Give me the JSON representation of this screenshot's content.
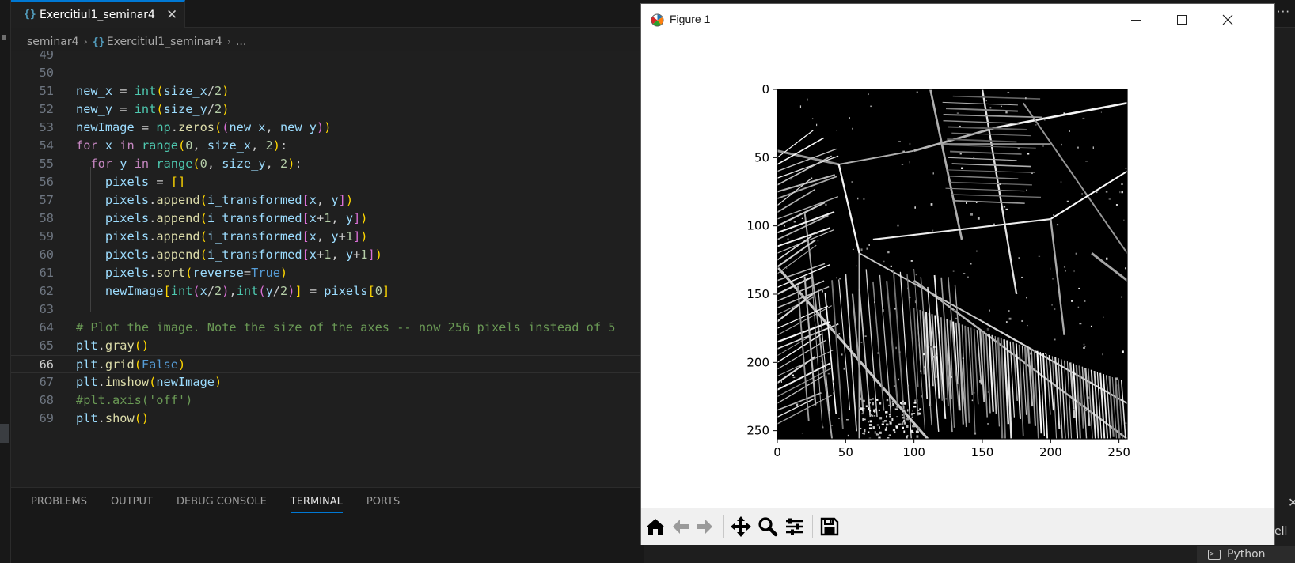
{
  "editor_tab": {
    "label": "Exercitiul1_seminar4",
    "close_glyph": "✕",
    "icon": "python-file-icon"
  },
  "more_actions_glyph": "···",
  "breadcrumb": {
    "folder": "seminar4",
    "file": "Exercitiul1_seminar4",
    "symbol": "..."
  },
  "editor": {
    "current_line": 66,
    "lines": [
      {
        "n": "49",
        "tokens": []
      },
      {
        "n": "50",
        "tokens": []
      },
      {
        "n": "51",
        "tokens": [
          [
            "new_x",
            "t-var"
          ],
          [
            " = ",
            "t-plain"
          ],
          [
            "int",
            "t-type"
          ],
          [
            "(",
            "t-paren1"
          ],
          [
            "size_x",
            "t-var"
          ],
          [
            "/",
            "t-plain"
          ],
          [
            "2",
            "t-num"
          ],
          [
            ")",
            "t-paren1"
          ]
        ]
      },
      {
        "n": "52",
        "tokens": [
          [
            "new_y",
            "t-var"
          ],
          [
            " = ",
            "t-plain"
          ],
          [
            "int",
            "t-type"
          ],
          [
            "(",
            "t-paren1"
          ],
          [
            "size_y",
            "t-var"
          ],
          [
            "/",
            "t-plain"
          ],
          [
            "2",
            "t-num"
          ],
          [
            ")",
            "t-paren1"
          ]
        ]
      },
      {
        "n": "53",
        "tokens": [
          [
            "newImage",
            "t-var"
          ],
          [
            " = ",
            "t-plain"
          ],
          [
            "np",
            "t-type"
          ],
          [
            ".",
            "t-plain"
          ],
          [
            "zeros",
            "t-func"
          ],
          [
            "(",
            "t-paren1"
          ],
          [
            "(",
            "t-paren2"
          ],
          [
            "new_x",
            "t-var"
          ],
          [
            ", ",
            "t-plain"
          ],
          [
            "new_y",
            "t-var"
          ],
          [
            ")",
            "t-paren2"
          ],
          [
            ")",
            "t-paren1"
          ]
        ]
      },
      {
        "n": "54",
        "tokens": [
          [
            "for",
            "t-kw"
          ],
          [
            " ",
            "t-plain"
          ],
          [
            "x",
            "t-var"
          ],
          [
            " ",
            "t-plain"
          ],
          [
            "in",
            "t-kw"
          ],
          [
            " ",
            "t-plain"
          ],
          [
            "range",
            "t-type"
          ],
          [
            "(",
            "t-paren1"
          ],
          [
            "0",
            "t-num"
          ],
          [
            ", ",
            "t-plain"
          ],
          [
            "size_x",
            "t-var"
          ],
          [
            ", ",
            "t-plain"
          ],
          [
            "2",
            "t-num"
          ],
          [
            ")",
            "t-paren1"
          ],
          [
            ":",
            "t-plain"
          ]
        ]
      },
      {
        "n": "55",
        "tokens": [
          [
            "  ",
            "t-plain"
          ],
          [
            "for",
            "t-kw"
          ],
          [
            " ",
            "t-plain"
          ],
          [
            "y",
            "t-var"
          ],
          [
            " ",
            "t-plain"
          ],
          [
            "in",
            "t-kw"
          ],
          [
            " ",
            "t-plain"
          ],
          [
            "range",
            "t-type"
          ],
          [
            "(",
            "t-paren1"
          ],
          [
            "0",
            "t-num"
          ],
          [
            ", ",
            "t-plain"
          ],
          [
            "size_y",
            "t-var"
          ],
          [
            ", ",
            "t-plain"
          ],
          [
            "2",
            "t-num"
          ],
          [
            ")",
            "t-paren1"
          ],
          [
            ":",
            "t-plain"
          ]
        ]
      },
      {
        "n": "56",
        "tokens": [
          [
            "    ",
            "t-plain"
          ],
          [
            "pixels",
            "t-var"
          ],
          [
            " = ",
            "t-plain"
          ],
          [
            "[]",
            "t-paren1"
          ]
        ]
      },
      {
        "n": "57",
        "tokens": [
          [
            "    ",
            "t-plain"
          ],
          [
            "pixels",
            "t-var"
          ],
          [
            ".",
            "t-plain"
          ],
          [
            "append",
            "t-func"
          ],
          [
            "(",
            "t-paren1"
          ],
          [
            "i_transformed",
            "t-var"
          ],
          [
            "[",
            "t-paren2"
          ],
          [
            "x",
            "t-var"
          ],
          [
            ", ",
            "t-plain"
          ],
          [
            "y",
            "t-var"
          ],
          [
            "]",
            "t-paren2"
          ],
          [
            ")",
            "t-paren1"
          ]
        ]
      },
      {
        "n": "58",
        "tokens": [
          [
            "    ",
            "t-plain"
          ],
          [
            "pixels",
            "t-var"
          ],
          [
            ".",
            "t-plain"
          ],
          [
            "append",
            "t-func"
          ],
          [
            "(",
            "t-paren1"
          ],
          [
            "i_transformed",
            "t-var"
          ],
          [
            "[",
            "t-paren2"
          ],
          [
            "x",
            "t-var"
          ],
          [
            "+",
            "t-plain"
          ],
          [
            "1",
            "t-num"
          ],
          [
            ", ",
            "t-plain"
          ],
          [
            "y",
            "t-var"
          ],
          [
            "]",
            "t-paren2"
          ],
          [
            ")",
            "t-paren1"
          ]
        ]
      },
      {
        "n": "59",
        "tokens": [
          [
            "    ",
            "t-plain"
          ],
          [
            "pixels",
            "t-var"
          ],
          [
            ".",
            "t-plain"
          ],
          [
            "append",
            "t-func"
          ],
          [
            "(",
            "t-paren1"
          ],
          [
            "i_transformed",
            "t-var"
          ],
          [
            "[",
            "t-paren2"
          ],
          [
            "x",
            "t-var"
          ],
          [
            ", ",
            "t-plain"
          ],
          [
            "y",
            "t-var"
          ],
          [
            "+",
            "t-plain"
          ],
          [
            "1",
            "t-num"
          ],
          [
            "]",
            "t-paren2"
          ],
          [
            ")",
            "t-paren1"
          ]
        ]
      },
      {
        "n": "60",
        "tokens": [
          [
            "    ",
            "t-plain"
          ],
          [
            "pixels",
            "t-var"
          ],
          [
            ".",
            "t-plain"
          ],
          [
            "append",
            "t-func"
          ],
          [
            "(",
            "t-paren1"
          ],
          [
            "i_transformed",
            "t-var"
          ],
          [
            "[",
            "t-paren2"
          ],
          [
            "x",
            "t-var"
          ],
          [
            "+",
            "t-plain"
          ],
          [
            "1",
            "t-num"
          ],
          [
            ", ",
            "t-plain"
          ],
          [
            "y",
            "t-var"
          ],
          [
            "+",
            "t-plain"
          ],
          [
            "1",
            "t-num"
          ],
          [
            "]",
            "t-paren2"
          ],
          [
            ")",
            "t-paren1"
          ]
        ]
      },
      {
        "n": "61",
        "tokens": [
          [
            "    ",
            "t-plain"
          ],
          [
            "pixels",
            "t-var"
          ],
          [
            ".",
            "t-plain"
          ],
          [
            "sort",
            "t-func"
          ],
          [
            "(",
            "t-paren1"
          ],
          [
            "reverse",
            "t-var"
          ],
          [
            "=",
            "t-plain"
          ],
          [
            "True",
            "t-const"
          ],
          [
            ")",
            "t-paren1"
          ]
        ]
      },
      {
        "n": "62",
        "tokens": [
          [
            "    ",
            "t-plain"
          ],
          [
            "newImage",
            "t-var"
          ],
          [
            "[",
            "t-paren1"
          ],
          [
            "int",
            "t-type"
          ],
          [
            "(",
            "t-paren2"
          ],
          [
            "x",
            "t-var"
          ],
          [
            "/",
            "t-plain"
          ],
          [
            "2",
            "t-num"
          ],
          [
            ")",
            "t-paren2"
          ],
          [
            ",",
            "t-plain"
          ],
          [
            "int",
            "t-type"
          ],
          [
            "(",
            "t-paren2"
          ],
          [
            "y",
            "t-var"
          ],
          [
            "/",
            "t-plain"
          ],
          [
            "2",
            "t-num"
          ],
          [
            ")",
            "t-paren2"
          ],
          [
            "]",
            "t-paren1"
          ],
          [
            " = ",
            "t-plain"
          ],
          [
            "pixels",
            "t-var"
          ],
          [
            "[",
            "t-paren1"
          ],
          [
            "0",
            "t-num"
          ],
          [
            "]",
            "t-paren1"
          ]
        ]
      },
      {
        "n": "63",
        "tokens": []
      },
      {
        "n": "64",
        "tokens": [
          [
            "# Plot the image. Note the size of the axes -- now 256 pixels instead of 5",
            "t-comment"
          ]
        ]
      },
      {
        "n": "65",
        "tokens": [
          [
            "plt",
            "t-var"
          ],
          [
            ".",
            "t-plain"
          ],
          [
            "gray",
            "t-func"
          ],
          [
            "(",
            "t-paren1"
          ],
          [
            ")",
            "t-paren1"
          ]
        ]
      },
      {
        "n": "66",
        "tokens": [
          [
            "plt",
            "t-var"
          ],
          [
            ".",
            "t-plain"
          ],
          [
            "grid",
            "t-func"
          ],
          [
            "(",
            "t-paren1"
          ],
          [
            "False",
            "t-const"
          ],
          [
            ")",
            "t-paren1"
          ]
        ]
      },
      {
        "n": "67",
        "tokens": [
          [
            "plt",
            "t-var"
          ],
          [
            ".",
            "t-plain"
          ],
          [
            "imshow",
            "t-func"
          ],
          [
            "(",
            "t-paren1"
          ],
          [
            "newImage",
            "t-var"
          ],
          [
            ")",
            "t-paren1"
          ]
        ]
      },
      {
        "n": "68",
        "tokens": [
          [
            "#plt.axis('off')",
            "t-comment"
          ]
        ]
      },
      {
        "n": "69",
        "tokens": [
          [
            "plt",
            "t-var"
          ],
          [
            ".",
            "t-plain"
          ],
          [
            "show",
            "t-func"
          ],
          [
            "(",
            "t-paren1"
          ],
          [
            ")",
            "t-paren1"
          ]
        ]
      }
    ]
  },
  "panel_tabs": [
    {
      "label": "PROBLEMS",
      "active": false
    },
    {
      "label": "OUTPUT",
      "active": false
    },
    {
      "label": "DEBUG CONSOLE",
      "active": false
    },
    {
      "label": "TERMINAL",
      "active": true
    },
    {
      "label": "PORTS",
      "active": false
    }
  ],
  "right_panel": {
    "close_glyph": "✕",
    "partial_text": "ell"
  },
  "status_bar": {
    "language": "Python",
    "icon": "terminal-icon"
  },
  "figure_window": {
    "title": "Figure 1",
    "app_icon": "matplotlib-icon",
    "buttons": {
      "minimize": "minimize-icon",
      "maximize": "maximize-icon",
      "close": "close-icon"
    },
    "toolbar": [
      "home-icon",
      "back-arrow-icon",
      "forward-arrow-icon",
      "pan-icon",
      "zoom-icon",
      "configure-subplots-icon",
      "save-icon"
    ],
    "colors": {
      "toolbar_bg": "#f0f0f0",
      "image_bg": "#000000",
      "axis": "#000000"
    }
  },
  "chart_data": {
    "type": "heatmap",
    "image": "grayscale edge-detected photo of a staircase (pooled 256x256 image)",
    "colormap": "gray",
    "grid": false,
    "xlim": [
      0,
      256
    ],
    "ylim": [
      256,
      0
    ],
    "x_ticks": [
      "0",
      "50",
      "100",
      "150",
      "200",
      "250"
    ],
    "y_ticks": [
      "0",
      "50",
      "100",
      "150",
      "200",
      "250"
    ],
    "x_tick_values": [
      0,
      50,
      100,
      150,
      200,
      250
    ],
    "y_tick_values": [
      0,
      50,
      100,
      150,
      200,
      250
    ]
  }
}
